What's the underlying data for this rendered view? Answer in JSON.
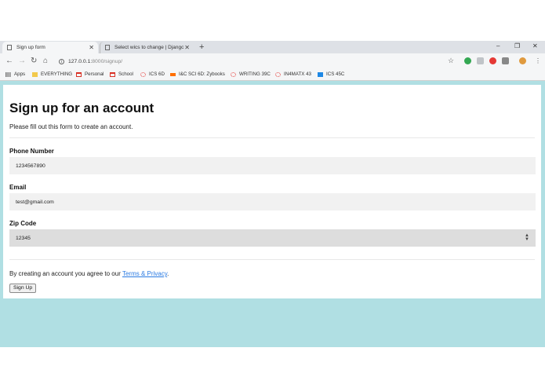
{
  "browser": {
    "tabs": [
      {
        "label": "Sign up form"
      },
      {
        "label": "Select wics to change | Django si"
      }
    ],
    "url": {
      "host": "127.0.0.1:",
      "rest": "8000/signup/"
    },
    "bookmarks": [
      {
        "label": "Apps",
        "icon": "apps-grid-icon",
        "color": "#888888"
      },
      {
        "label": "EVERYTHING",
        "icon": "folder-icon",
        "color": "#f2c94c"
      },
      {
        "label": "Personal",
        "icon": "gmail-icon",
        "color": "#d93025"
      },
      {
        "label": "School",
        "icon": "gmail-icon",
        "color": "#d93025"
      },
      {
        "label": "ICS 6D",
        "icon": "circle-logo-icon",
        "color": "#e53935"
      },
      {
        "label": "I&C SCI 6D: Zybooks",
        "icon": "zybooks-icon",
        "color": "#ff6f00"
      },
      {
        "label": "WRITING 39C",
        "icon": "circle-logo-icon",
        "color": "#e53935"
      },
      {
        "label": "IN4MATX 43",
        "icon": "circle-logo-icon",
        "color": "#e53935"
      },
      {
        "label": "ICS 45C",
        "icon": "grid-logo-icon",
        "color": "#1e88e5"
      }
    ]
  },
  "form": {
    "title": "Sign up for an account",
    "subtitle": "Please fill out this form to create an account.",
    "phone": {
      "label": "Phone Number",
      "value": "1234567890"
    },
    "email": {
      "label": "Email",
      "value": "test@gmail.com"
    },
    "zip": {
      "label": "Zip Code",
      "value": "12345"
    },
    "terms": {
      "prefix": "By creating an account you agree to our ",
      "link": "Terms & Privacy",
      "suffix": "."
    },
    "submit_label": "Sign Up"
  }
}
